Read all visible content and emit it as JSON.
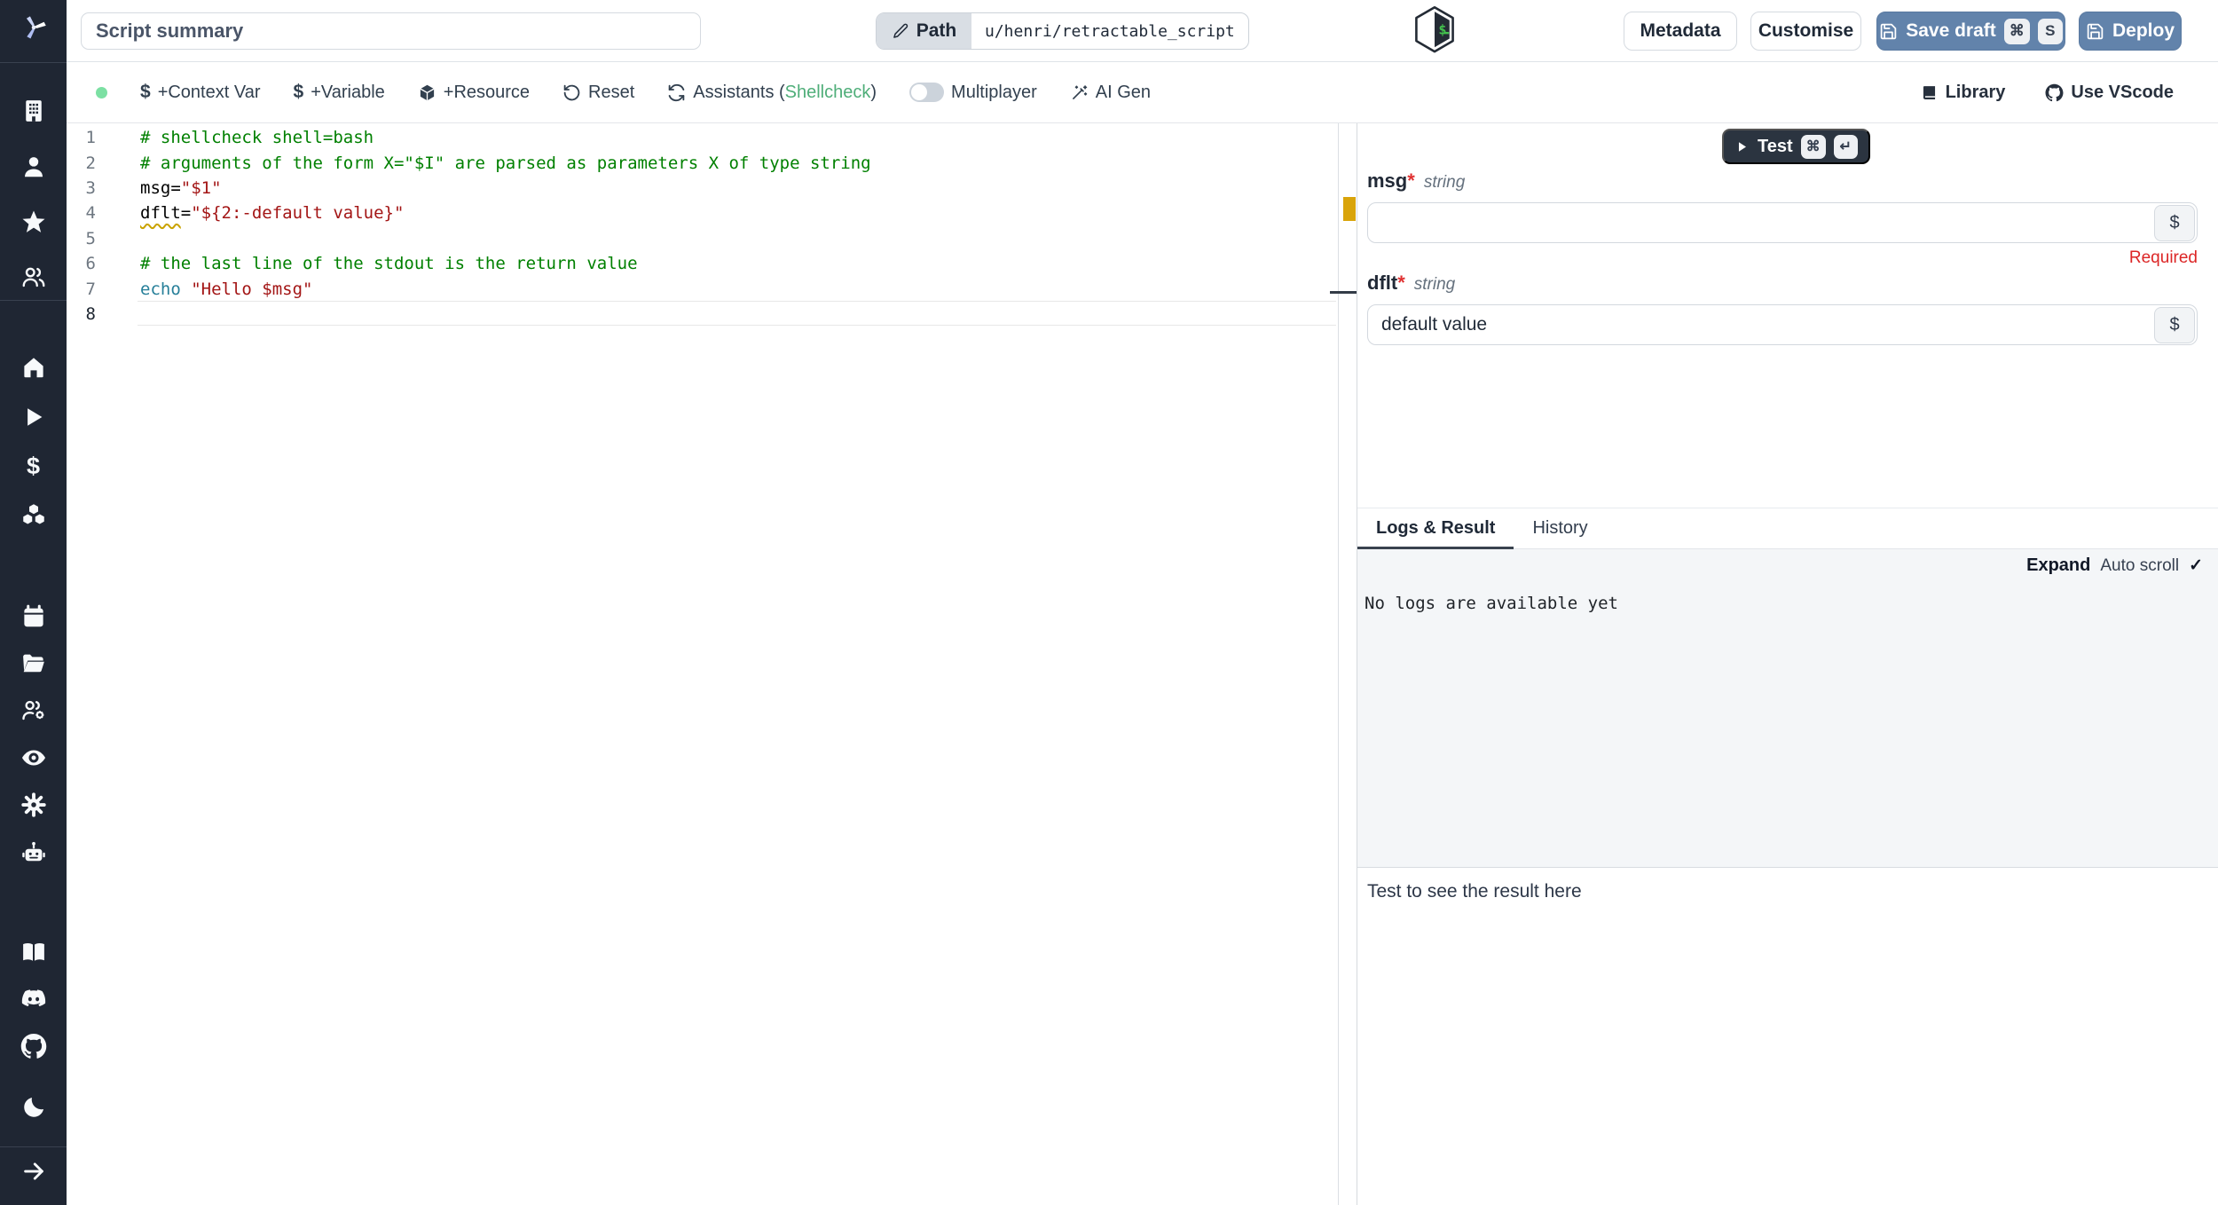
{
  "topbar": {
    "summary_placeholder": "Script summary",
    "path_label": "Path",
    "path_value": "u/henri/retractable_script",
    "metadata": "Metadata",
    "customise": "Customise",
    "save_draft": "Save draft",
    "save_kbd_mod": "⌘",
    "save_kbd_key": "S",
    "deploy": "Deploy"
  },
  "toolbar": {
    "context_var": "+Context Var",
    "variable": "+Variable",
    "resource": "+Resource",
    "reset": "Reset",
    "assistants_prefix": "Assistants (",
    "assistants_name": "Shellcheck",
    "assistants_suffix": ")",
    "multiplayer": "Multiplayer",
    "ai_gen": "AI Gen",
    "library": "Library",
    "use_vscode": "Use VScode",
    "dollar_icon": "$"
  },
  "editor": {
    "language": "bash",
    "colors": {
      "comment": "#008000",
      "string": "#a31515",
      "builtin": "#267f99",
      "plain": "#000000"
    },
    "lines": [
      {
        "n": "1",
        "tokens": [
          {
            "t": "# shellcheck shell=bash",
            "c": "comment"
          }
        ]
      },
      {
        "n": "2",
        "tokens": [
          {
            "t": "# arguments of the form X=\"$I\" are parsed as parameters X of type string",
            "c": "comment"
          }
        ]
      },
      {
        "n": "3",
        "tokens": [
          {
            "t": "msg=",
            "c": "plain"
          },
          {
            "t": "\"$1\"",
            "c": "string"
          }
        ]
      },
      {
        "n": "4",
        "tokens": [
          {
            "t": "dflt",
            "c": "plain",
            "squiggle": true
          },
          {
            "t": "=",
            "c": "plain"
          },
          {
            "t": "\"${2:-default value}\"",
            "c": "string"
          }
        ]
      },
      {
        "n": "5",
        "tokens": []
      },
      {
        "n": "6",
        "tokens": [
          {
            "t": "# the last line of the stdout is the return value",
            "c": "comment"
          }
        ]
      },
      {
        "n": "7",
        "tokens": [
          {
            "t": "echo",
            "c": "builtin"
          },
          {
            "t": " ",
            "c": "plain"
          },
          {
            "t": "\"Hello $msg\"",
            "c": "string"
          }
        ]
      },
      {
        "n": "8",
        "tokens": [],
        "active": true
      }
    ]
  },
  "run_panel": {
    "test": "Test",
    "test_kbd_mod": "⌘",
    "test_kbd_key": "↵",
    "dollar_button": "$",
    "args": [
      {
        "name": "msg",
        "required_mark": "*",
        "type": "string",
        "value": "",
        "error": "Required"
      },
      {
        "name": "dflt",
        "required_mark": "*",
        "type": "string",
        "value": "default value",
        "error": ""
      }
    ],
    "tabs": [
      "Logs & Result",
      "History"
    ],
    "expand": "Expand",
    "autoscroll": "Auto scroll",
    "check": "✓",
    "no_logs": "No logs are available yet",
    "result_hint": "Test to see the result here"
  },
  "sidebar": {
    "icons": [
      "building",
      "user",
      "star",
      "users",
      "home",
      "play",
      "dollar",
      "cubes",
      "calendar",
      "folder-open",
      "users-cog",
      "eye",
      "gear",
      "robot",
      "book-open",
      "discord",
      "github",
      "moon",
      "arrow-right"
    ]
  },
  "status": {
    "connected_dot_color": "#7ce0a3"
  },
  "colors": {
    "sidebar_bg": "#1f2633",
    "primary_button": "#6283ab",
    "test_button": "#2b3440",
    "required_red": "#dc2626",
    "shellcheck_green": "#4fae79",
    "warning_gold": "#d9a40a"
  }
}
